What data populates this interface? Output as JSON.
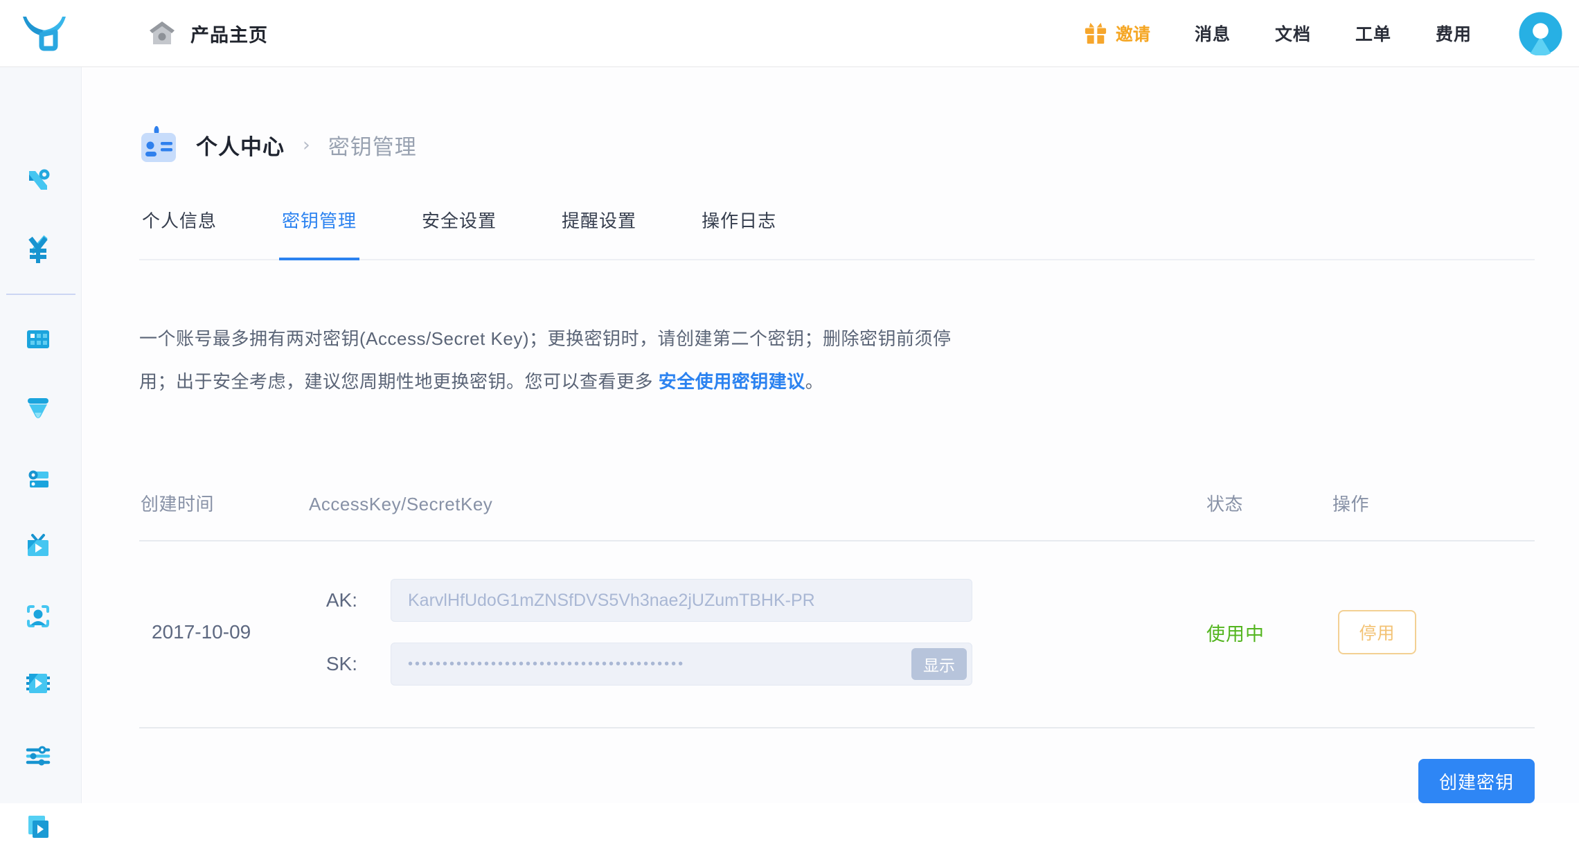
{
  "header": {
    "title": "产品主页",
    "invite_label": "邀请",
    "nav": [
      {
        "label": "消息"
      },
      {
        "label": "文档"
      },
      {
        "label": "工单"
      },
      {
        "label": "费用"
      }
    ]
  },
  "sidebar": {
    "icons": [
      "nav-logo-n-icon",
      "billing-yen-icon",
      "apps-grid-icon",
      "data-funnel-icon",
      "list-config-icon",
      "live-tv-icon",
      "face-recognition-icon",
      "media-codec-icon",
      "tuning-sliders-icon",
      "video-player-icon"
    ]
  },
  "breadcrumb": {
    "section": "个人中心",
    "separator": "›",
    "current": "密钥管理"
  },
  "tabs": [
    {
      "label": "个人信息",
      "active": false
    },
    {
      "label": "密钥管理",
      "active": true
    },
    {
      "label": "安全设置",
      "active": false
    },
    {
      "label": "提醒设置",
      "active": false
    },
    {
      "label": "操作日志",
      "active": false
    }
  ],
  "notice": {
    "line1": "一个账号最多拥有两对密钥(Access/Secret Key)；更换密钥时，请创建第二个密钥；删除密钥前须停",
    "line2": "用；出于安全考虑，建议您周期性地更换密钥。您可以查看更多 ",
    "link": "安全使用密钥建议",
    "period": "。"
  },
  "keys_table": {
    "headers": [
      "创建时间",
      "AccessKey/SecretKey",
      "状态",
      "操作"
    ],
    "rows": [
      {
        "created": "2017-10-09",
        "ak_label": "AK:",
        "ak_value": "KarvlHfUdoG1mZNSfDVS5Vh3nae2jUZumTBHK-PR",
        "sk_label": "SK:",
        "sk_masked": "••••••••••••••••••••••••••••••••••••••••",
        "show_button": "显示",
        "status": "使用中",
        "action": "停用"
      }
    ]
  },
  "create_button": "创建密钥",
  "colors": {
    "accent_blue": "#2b82f0",
    "brand_cyan": "#29b2e4",
    "invite_orange": "#f5a623",
    "status_green": "#53b51f",
    "action_orange": "#f3c273",
    "sidebar_bg": "#f6f8fb"
  }
}
